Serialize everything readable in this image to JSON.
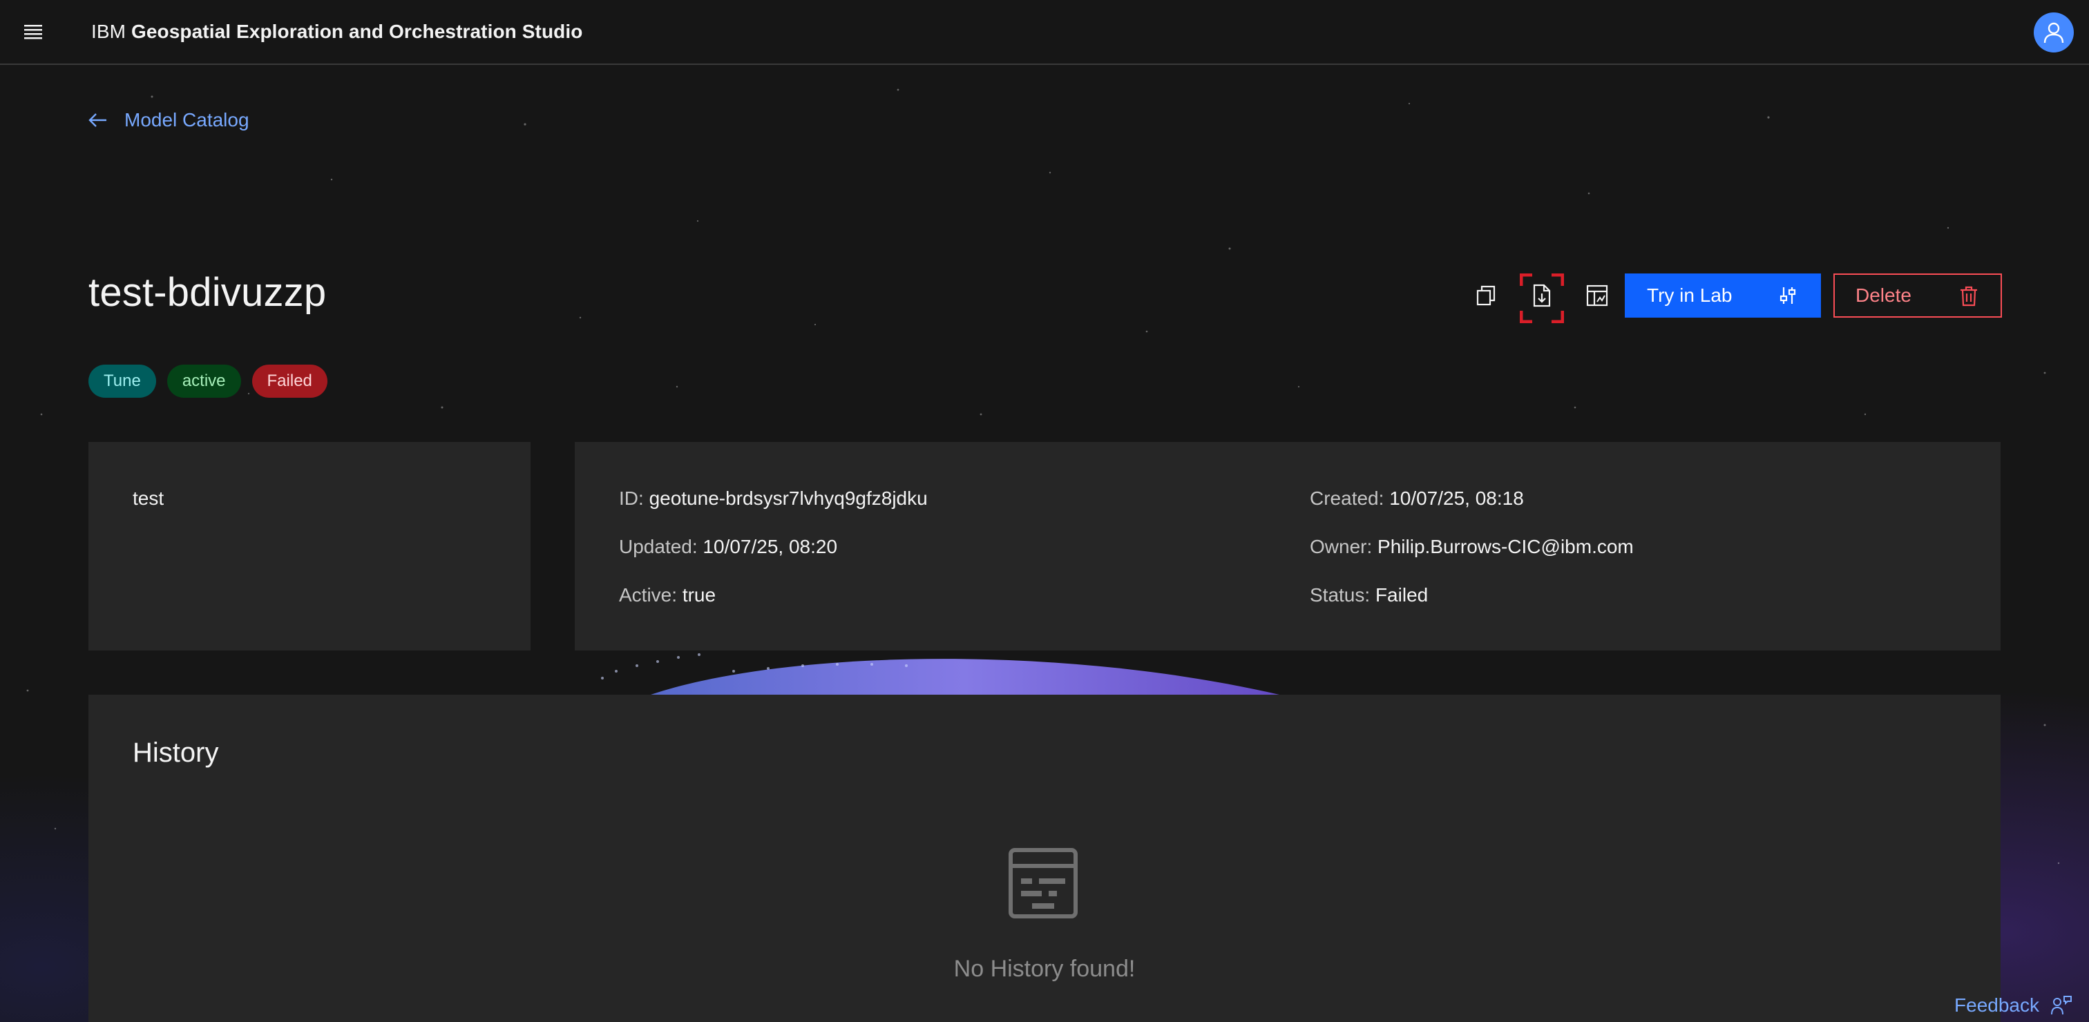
{
  "header": {
    "brand_prefix": "IBM",
    "brand_name": "Geospatial Exploration and Orchestration Studio"
  },
  "back_link": {
    "label": "Model Catalog"
  },
  "model": {
    "title": "test-bdivuzzp",
    "tags": [
      "Tune",
      "active",
      "Failed"
    ]
  },
  "actions": {
    "try_label": "Try in Lab",
    "delete_label": "Delete"
  },
  "description": {
    "text": "test"
  },
  "details": {
    "id_label": "ID:",
    "id_value": "geotune-brdsysr7lvhyq9gfz8jdku",
    "updated_label": "Updated:",
    "updated_value": "10/07/25, 08:20",
    "active_label": "Active:",
    "active_value": "true",
    "created_label": "Created:",
    "created_value": "10/07/25, 08:18",
    "owner_label": "Owner:",
    "owner_value": "Philip.Burrows-CIC@ibm.com",
    "status_label": "Status:",
    "status_value": "Failed"
  },
  "history": {
    "title": "History",
    "empty_text": "No History found!"
  },
  "feedback": {
    "label": "Feedback"
  },
  "colors": {
    "accent": "#0f62fe",
    "danger": "#fa4d56",
    "link": "#78a9ff",
    "card": "#262626",
    "background": "#161616"
  }
}
